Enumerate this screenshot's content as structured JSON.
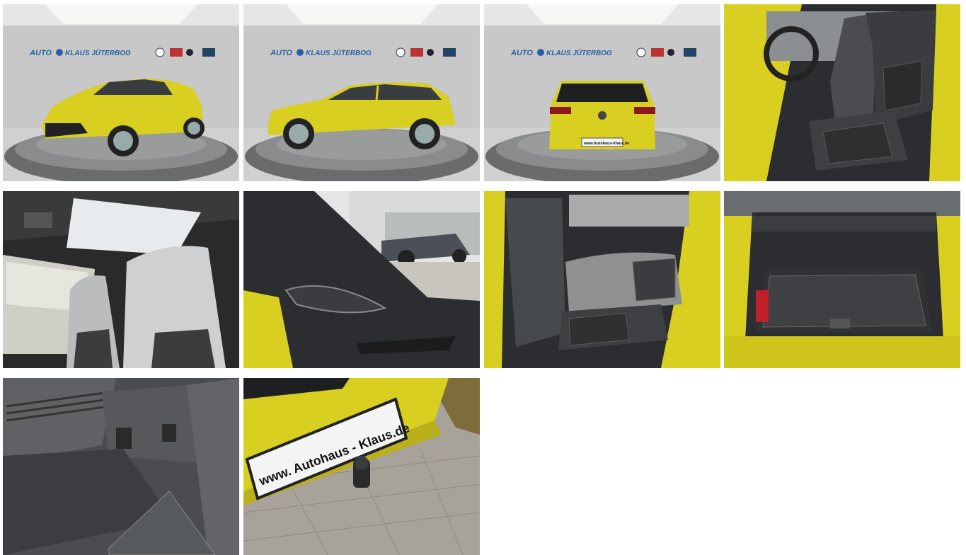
{
  "gallery": {
    "photos": [
      {
        "subject": "front-three-quarter-view"
      },
      {
        "subject": "side-profile-view"
      },
      {
        "subject": "rear-view"
      },
      {
        "subject": "front-seats"
      },
      {
        "subject": "sunroof-and-front-seats"
      },
      {
        "subject": "a-pillar-speaker"
      },
      {
        "subject": "rear-seats"
      },
      {
        "subject": "trunk"
      },
      {
        "subject": "trunk-side-panel"
      },
      {
        "subject": "rear-plate-tow-hitch"
      }
    ]
  },
  "showroom": {
    "sign_brand": "AUTO",
    "sign_name": "KLAUS JÜTERBOG"
  },
  "plate": {
    "text": "www. Autohaus - Klaus.de"
  },
  "rear_plate_small": {
    "text": "www.Autohaus-Klaus.de"
  },
  "colors": {
    "car_yellow": "#d8cf20",
    "interior_dark": "#2b2d30",
    "showroom_wall": "#cfd0cf"
  }
}
